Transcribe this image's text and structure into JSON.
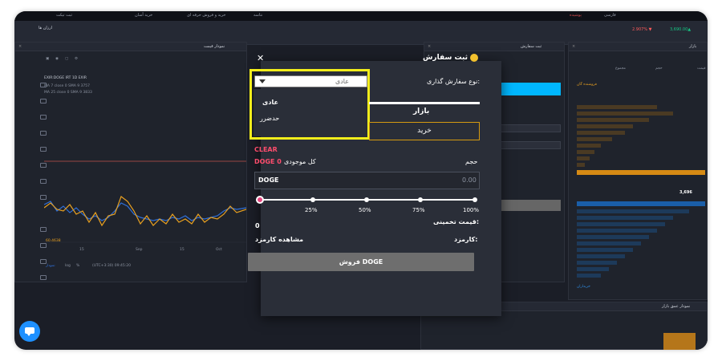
{
  "colors": {
    "accent_yellow": "#f2ed1b",
    "buy_border": "#d59a10",
    "clear_red": "#ff4d6d",
    "knob_pink": "#e5457f",
    "bg_dark": "#1b1e27",
    "modal_bg": "#2a2e38",
    "sell_btn": "#6e6e6e"
  },
  "topbar": {
    "link1": "ثبت تیکت",
    "link2": "خرید آسان",
    "link3": "خرید و فروش حرفه ای",
    "link4": "نتاسه",
    "user": "پوشیده",
    "lang": "فارسی",
    "price1": "2.907% ▼",
    "price2": "3,690.00▲"
  },
  "secbar": {
    "tab_label": "ارزان ها"
  },
  "panels": {
    "chart_title": "نمودار قیمت",
    "orders_title": "ثبت سفارش",
    "market_title": "بازار",
    "depth_title": "نمودار عمق بازار",
    "chart_legend1": "EXIR:DOGE IRT  1D  EXIR",
    "chart_legend2": "MA 7 close 0 SMA 9  3757",
    "chart_legend3": "MA 25 close 0 SMA 9  3833",
    "chart_price_label": "60.4638",
    "chart_time_label": "(UTC+3:30) 09:45:20",
    "x_tick1": "15",
    "x_tick2": "Sep",
    "x_tick3": "15",
    "x_tick4": "Oct",
    "chart_bottom_left": "نمودار",
    "chart_bottom_log": "log",
    "chart_bottom_pct": "%",
    "mid_price": "3,696",
    "sell_orders_label": "فروشنده گان",
    "buy_orders_label": "خریداران",
    "col_price": "قیمت",
    "col_volume": "حجم",
    "col_total": "مجموع"
  },
  "modal": {
    "title": "ثبت سفارش",
    "close_icon": "close-icon",
    "order_type_label": "نوع سفارش گذاری:",
    "order_type_value": "عادی",
    "dropdown_options": [
      "عادی",
      "حدضرر"
    ],
    "tab_market": "بازار",
    "buy_button": "خرید",
    "clear": "CLEAR",
    "volume_label": "حجم",
    "balance_label": "کل موجودی",
    "balance_value": "DOGE 0",
    "qty_unit": "DOGE",
    "qty_value": "0.00",
    "slider_marks": [
      "25%",
      "50%",
      "75%",
      "100%"
    ],
    "estimate_label": "قیمت تخمینی:",
    "estimate_value": "0",
    "fee_label": "کارمزد:",
    "fee_link": "مشاهده کارمزد",
    "sell_button": "فروش DOGE"
  }
}
